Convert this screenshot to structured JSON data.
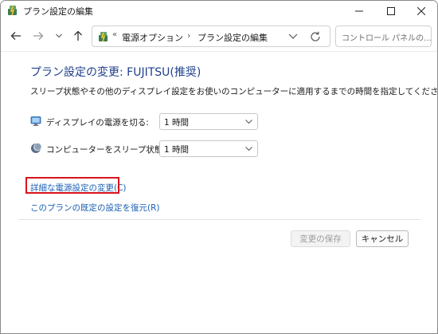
{
  "window": {
    "title": "プラン設定の編集"
  },
  "nav": {
    "breadcrumb_sep": "«",
    "crumb1": "電源オプション",
    "crumb_sep": "›",
    "crumb2": "プラン設定の編集",
    "search_placeholder": "コントロール パネルの..."
  },
  "content": {
    "heading": "プラン設定の変更: FUJITSU(推奨)",
    "description": "スリープ状態やその他のディスプレイ設定をお使いのコンピューターに適用するまでの時間を指定してください。",
    "settings": [
      {
        "label": "ディスプレイの電源を切る:",
        "value": "1 時間",
        "icon": "display-power-icon"
      },
      {
        "label": "コンピューターをスリープ状態にする:",
        "value": "1 時間",
        "icon": "sleep-moon-icon"
      }
    ],
    "advanced_link": "詳細な電源設定の変更(C)",
    "restore_link": "このプランの既定の設定を復元(R)"
  },
  "footer": {
    "save_label": "変更の保存",
    "cancel_label": "キャンセル"
  },
  "colors": {
    "heading": "#1e3f8a",
    "link": "#1a5fb4",
    "highlight_border": "#d9141b"
  }
}
